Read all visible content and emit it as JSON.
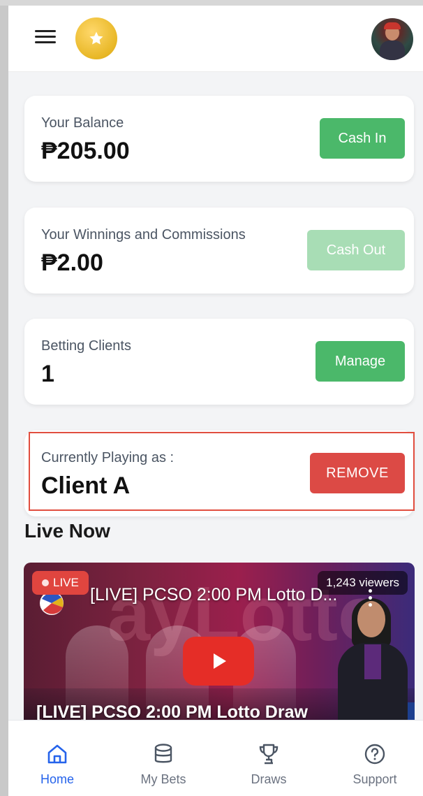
{
  "header": {
    "menu_icon": "hamburger-menu-icon",
    "badge_icon": "star-icon",
    "avatar": "user-avatar"
  },
  "balance_card": {
    "label": "Your Balance",
    "value": "₱205.00",
    "button": "Cash In"
  },
  "winnings_card": {
    "label": "Your Winnings and Commissions",
    "value": "₱2.00",
    "button": "Cash Out",
    "button_disabled": true
  },
  "clients_card": {
    "label": "Betting Clients",
    "value": "1",
    "button": "Manage"
  },
  "playing_card": {
    "label": "Currently Playing as :",
    "value": "Client A",
    "button": "REMOVE"
  },
  "live_section": {
    "title": "Live Now",
    "video": {
      "live_badge": "LIVE",
      "viewers": "1,243 viewers",
      "title_top": "[LIVE] PCSO 2:00 PM Lotto D...",
      "title_bottom": "[LIVE] PCSO 2:00 PM Lotto Draw",
      "background_text": "ayLotto"
    }
  },
  "bottom_nav": {
    "items": [
      {
        "label": "Home",
        "icon": "home-icon",
        "active": true
      },
      {
        "label": "My Bets",
        "icon": "database-icon",
        "active": false
      },
      {
        "label": "Draws",
        "icon": "trophy-icon",
        "active": false
      },
      {
        "label": "Support",
        "icon": "help-circle-icon",
        "active": false
      }
    ]
  },
  "colors": {
    "green": "#4bb86a",
    "green_disabled": "#a8ddb5",
    "red": "#dc4a45",
    "active_blue": "#2563eb",
    "highlight_border": "#e14e3f"
  }
}
